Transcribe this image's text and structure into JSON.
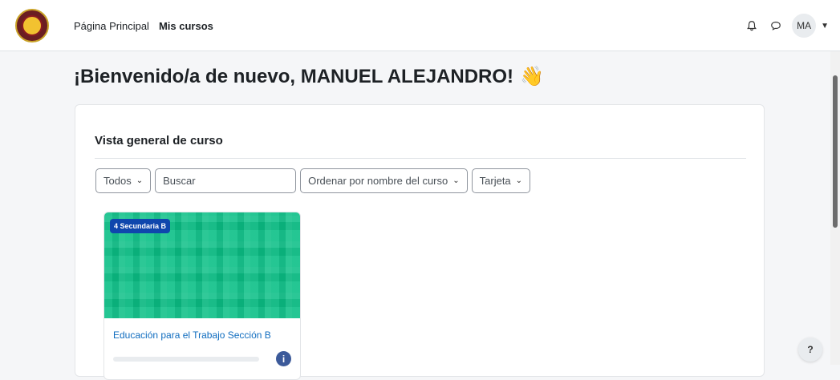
{
  "nav": {
    "links": [
      {
        "label": "Página Principal"
      },
      {
        "label": "Mis cursos"
      }
    ],
    "user_initials": "MA"
  },
  "main": {
    "welcome": "¡Bienvenido/a de nuevo, MANUEL ALEJANDRO!",
    "welcome_emoji": "👋"
  },
  "block": {
    "title": "Vista general de curso",
    "filter_all": "Todos",
    "search_placeholder": "Buscar",
    "sort": "Ordenar por nombre del curso",
    "view": "Tarjeta"
  },
  "course": {
    "badge": "4 Secundaria B",
    "name": "Educación para el Trabajo Sección B",
    "progress": 0
  },
  "help_label": "?",
  "colors": {
    "accent": "#0f6cbf",
    "course_bg": "#0bbf86",
    "badge": "#0f47ad"
  }
}
